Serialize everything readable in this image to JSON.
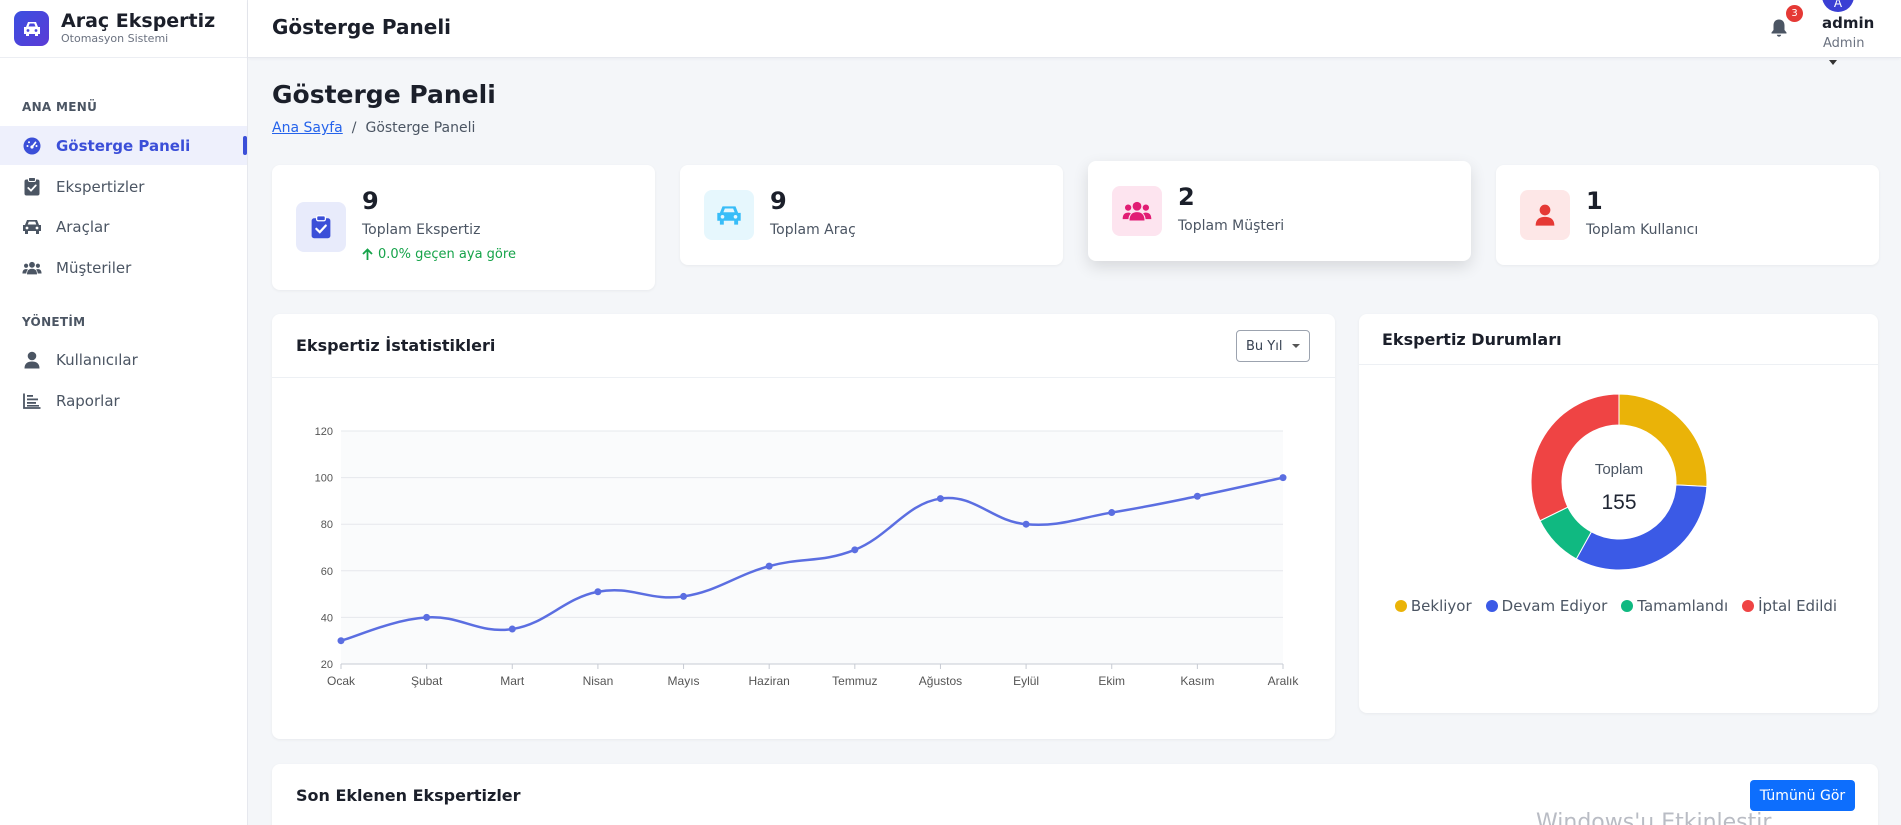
{
  "brand": {
    "title": "Araç Ekspertiz",
    "subtitle": "Otomasyon Sistemi"
  },
  "sidebar": {
    "section_main": "ANA MENÜ",
    "section_admin": "YÖNETİM",
    "items": [
      {
        "label": "Gösterge Paneli",
        "icon": "gauge-icon",
        "active": true
      },
      {
        "label": "Ekspertizler",
        "icon": "clipboard-check-icon"
      },
      {
        "label": "Araçlar",
        "icon": "car-icon"
      },
      {
        "label": "Müşteriler",
        "icon": "users-icon"
      },
      {
        "label": "Kullanıcılar",
        "icon": "user-icon"
      },
      {
        "label": "Raporlar",
        "icon": "chart-bar-icon"
      }
    ]
  },
  "topbar": {
    "title": "Gösterge Paneli",
    "notification_count": "3",
    "user_initial": "A",
    "user_name": "admin",
    "user_role": "Admin"
  },
  "page": {
    "title": "Gösterge Paneli",
    "breadcrumb_home": "Ana Sayfa",
    "breadcrumb_sep": "/",
    "breadcrumb_current": "Gösterge Paneli"
  },
  "stats": [
    {
      "value": "9",
      "label": "Toplam Ekspertiz",
      "trend": "0.0% geçen aya göre",
      "icon": "clipboard-check-icon",
      "color": "#3b4fd8",
      "bg": "#e8ebfb"
    },
    {
      "value": "9",
      "label": "Toplam Araç",
      "icon": "car-icon",
      "color": "#38bdf8",
      "bg": "#e6f7fd"
    },
    {
      "value": "2",
      "label": "Toplam Müşteri",
      "icon": "users-icon",
      "color": "#e11d74",
      "bg": "#fde4ef"
    },
    {
      "value": "1",
      "label": "Toplam Kullanıcı",
      "icon": "user-icon",
      "color": "#e53935",
      "bg": "#fde7e7"
    }
  ],
  "line_panel": {
    "title": "Ekspertiz İstatistikleri",
    "period": "Bu Yıl"
  },
  "donut_panel": {
    "title": "Ekspertiz Durumları",
    "center_label": "Toplam",
    "center_value": "155"
  },
  "recent_panel": {
    "title": "Son Eklenen Ekspertizler",
    "view_all": "Tümünü Gör"
  },
  "watermark": "Windows'u Etkinleştir",
  "chart_data": [
    {
      "type": "line",
      "categories": [
        "Ocak",
        "Şubat",
        "Mart",
        "Nisan",
        "Mayıs",
        "Haziran",
        "Temmuz",
        "Ağustos",
        "Eylül",
        "Ekim",
        "Kasım",
        "Aralık"
      ],
      "values": [
        30,
        40,
        35,
        51,
        49,
        62,
        69,
        91,
        80,
        85,
        92,
        100
      ],
      "ylim": [
        20,
        120
      ],
      "yticks": [
        20,
        40,
        60,
        80,
        100,
        120
      ],
      "color": "#5b6ee1",
      "grid": true
    },
    {
      "type": "pie",
      "donut": true,
      "labels": [
        "Bekliyor",
        "Devam Ediyor",
        "Tamamlandı",
        "İptal Edildi"
      ],
      "values": [
        40,
        50,
        15,
        50
      ],
      "colors": [
        "#eab308",
        "#3b5ae6",
        "#10b981",
        "#ef4444"
      ],
      "legend": "bottom"
    }
  ]
}
